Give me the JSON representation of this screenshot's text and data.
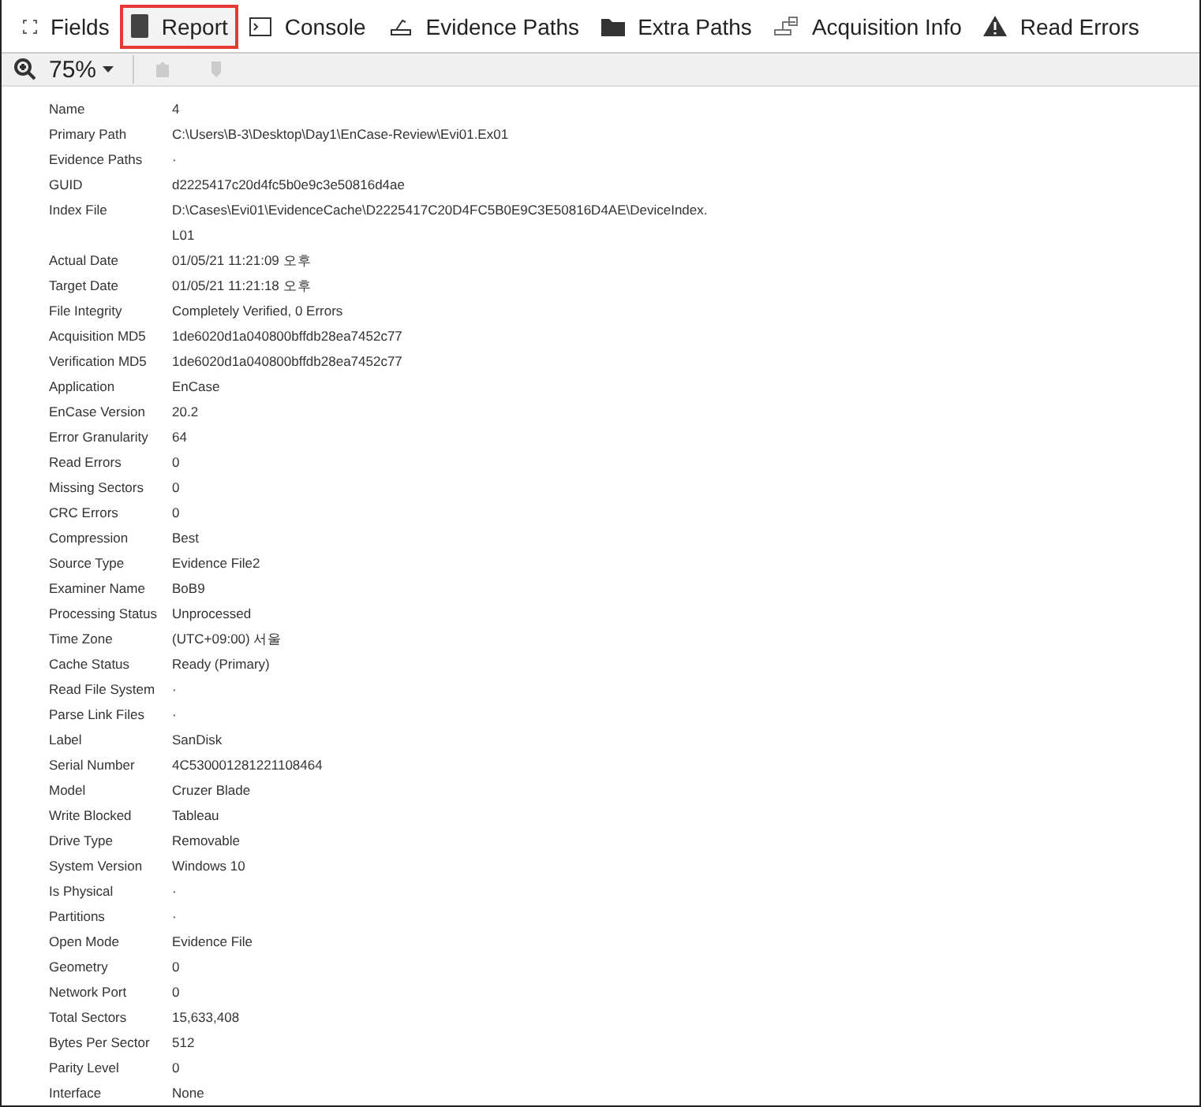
{
  "tabs": [
    {
      "label": "Fields",
      "selected": false
    },
    {
      "label": "Report",
      "selected": true
    },
    {
      "label": "Console",
      "selected": false
    },
    {
      "label": "Evidence Paths",
      "selected": false
    },
    {
      "label": "Extra Paths",
      "selected": false
    },
    {
      "label": "Acquisition Info",
      "selected": false
    },
    {
      "label": "Read Errors",
      "selected": false
    }
  ],
  "toolbar": {
    "zoom": "75%"
  },
  "rows": [
    {
      "label": "Name",
      "value": "4"
    },
    {
      "label": "Primary Path",
      "value": "C:\\Users\\B-3\\Desktop\\Day1\\EnCase-Review\\Evi01.Ex01"
    },
    {
      "label": "Evidence Paths",
      "value": "·"
    },
    {
      "label": "GUID",
      "value": "d2225417c20d4fc5b0e9c3e50816d4ae"
    },
    {
      "label": "Index File",
      "value": "D:\\Cases\\Evi01\\EvidenceCache\\D2225417C20D4FC5B0E9C3E50816D4AE\\DeviceIndex.\nL01"
    },
    {
      "label": "Actual Date",
      "value": "01/05/21 11:21:09 오후"
    },
    {
      "label": "Target Date",
      "value": "01/05/21 11:21:18 오후"
    },
    {
      "label": "File Integrity",
      "value": "Completely Verified, 0 Errors"
    },
    {
      "label": "Acquisition MD5",
      "value": "1de6020d1a040800bffdb28ea7452c77"
    },
    {
      "label": "Verification MD5",
      "value": "1de6020d1a040800bffdb28ea7452c77"
    },
    {
      "label": "Application",
      "value": "EnCase"
    },
    {
      "label": "EnCase Version",
      "value": "20.2"
    },
    {
      "label": "Error Granularity",
      "value": "64"
    },
    {
      "label": "Read Errors",
      "value": "0"
    },
    {
      "label": "Missing Sectors",
      "value": "0"
    },
    {
      "label": "CRC Errors",
      "value": "0"
    },
    {
      "label": "Compression",
      "value": "Best"
    },
    {
      "label": "Source Type",
      "value": "Evidence File2"
    },
    {
      "label": "Examiner Name",
      "value": "BoB9"
    },
    {
      "label": "Processing Status",
      "value": "Unprocessed"
    },
    {
      "label": "Time Zone",
      "value": "(UTC+09:00) 서울"
    },
    {
      "label": "Cache Status",
      "value": "Ready (Primary)"
    },
    {
      "label": "Read File System",
      "value": "·"
    },
    {
      "label": "Parse Link Files",
      "value": "·"
    },
    {
      "label": "Label",
      "value": "SanDisk"
    },
    {
      "label": "Serial Number",
      "value": "4C530001281221108464"
    },
    {
      "label": "Model",
      "value": "Cruzer Blade"
    },
    {
      "label": "Write Blocked",
      "value": "Tableau"
    },
    {
      "label": "Drive Type",
      "value": "Removable"
    },
    {
      "label": "System Version",
      "value": "Windows 10"
    },
    {
      "label": "Is Physical",
      "value": "·"
    },
    {
      "label": "Partitions",
      "value": "·"
    },
    {
      "label": "Open Mode",
      "value": "Evidence File"
    },
    {
      "label": "Geometry",
      "value": "0"
    },
    {
      "label": "Network Port",
      "value": "0"
    },
    {
      "label": "Total Sectors",
      "value": "15,633,408"
    },
    {
      "label": "Bytes Per Sector",
      "value": "512"
    },
    {
      "label": "Parity Level",
      "value": "0"
    },
    {
      "label": "Interface",
      "value": "None"
    }
  ]
}
